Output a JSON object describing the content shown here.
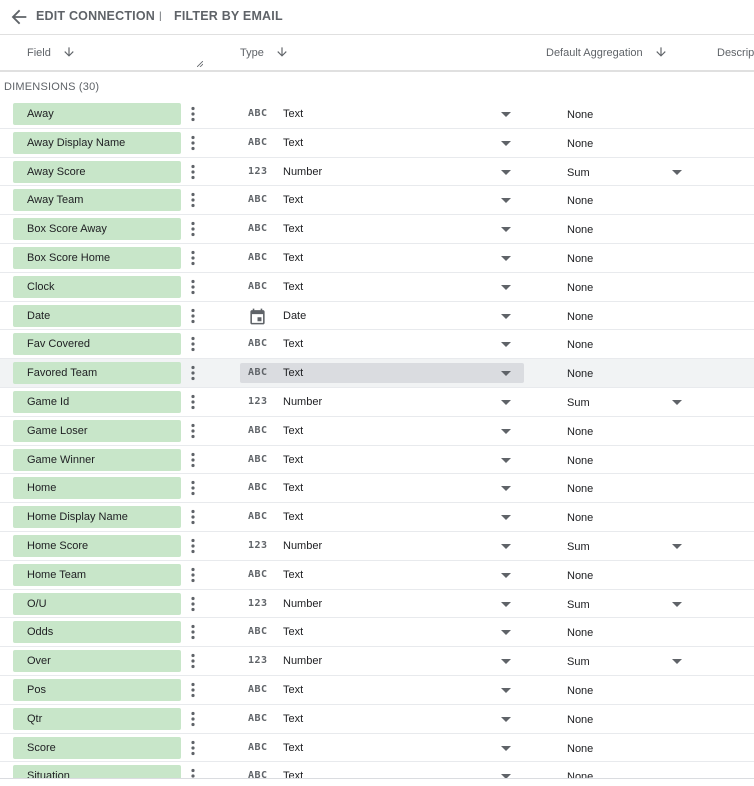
{
  "topbar": {
    "edit_label": "EDIT CONNECTION",
    "separator": "|",
    "filter_label": "FILTER BY EMAIL"
  },
  "columns": {
    "field": "Field",
    "type": "Type",
    "aggregation": "Default Aggregation",
    "description": "Descrip"
  },
  "section": {
    "label": "DIMENSIONS (30)"
  },
  "type_icons": {
    "Text": "ABC",
    "Number": "123",
    "Date": "calendar-icon"
  },
  "rows": [
    {
      "field": "Away",
      "type": "Text",
      "agg": "None"
    },
    {
      "field": "Away Display Name",
      "type": "Text",
      "agg": "None"
    },
    {
      "field": "Away Score",
      "type": "Number",
      "agg": "Sum"
    },
    {
      "field": "Away Team",
      "type": "Text",
      "agg": "None"
    },
    {
      "field": "Box Score Away",
      "type": "Text",
      "agg": "None"
    },
    {
      "field": "Box Score Home",
      "type": "Text",
      "agg": "None"
    },
    {
      "field": "Clock",
      "type": "Text",
      "agg": "None"
    },
    {
      "field": "Date",
      "type": "Date",
      "agg": "None"
    },
    {
      "field": "Fav Covered",
      "type": "Text",
      "agg": "None"
    },
    {
      "field": "Favored Team",
      "type": "Text",
      "agg": "None",
      "highlighted": true
    },
    {
      "field": "Game Id",
      "type": "Number",
      "agg": "Sum"
    },
    {
      "field": "Game Loser",
      "type": "Text",
      "agg": "None"
    },
    {
      "field": "Game Winner",
      "type": "Text",
      "agg": "None"
    },
    {
      "field": "Home",
      "type": "Text",
      "agg": "None"
    },
    {
      "field": "Home Display Name",
      "type": "Text",
      "agg": "None"
    },
    {
      "field": "Home Score",
      "type": "Number",
      "agg": "Sum"
    },
    {
      "field": "Home Team",
      "type": "Text",
      "agg": "None"
    },
    {
      "field": "O/U",
      "type": "Number",
      "agg": "Sum"
    },
    {
      "field": "Odds",
      "type": "Text",
      "agg": "None"
    },
    {
      "field": "Over",
      "type": "Number",
      "agg": "Sum"
    },
    {
      "field": "Pos",
      "type": "Text",
      "agg": "None"
    },
    {
      "field": "Qtr",
      "type": "Text",
      "agg": "None"
    },
    {
      "field": "Score",
      "type": "Text",
      "agg": "None"
    },
    {
      "field": "Situation",
      "type": "Text",
      "agg": "None"
    }
  ]
}
